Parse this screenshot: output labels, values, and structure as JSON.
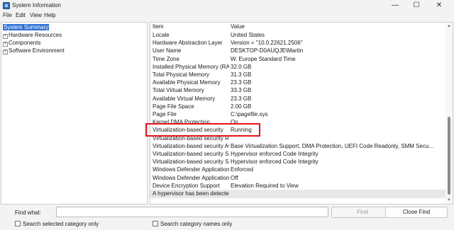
{
  "window": {
    "title": "System Information"
  },
  "menu": [
    "File",
    "Edit",
    "View",
    "Help"
  ],
  "tree": [
    {
      "label": "System Summary",
      "selected": true,
      "expandable": false
    },
    {
      "label": "Hardware Resources",
      "expandable": true
    },
    {
      "label": "Components",
      "expandable": true
    },
    {
      "label": "Software Environment",
      "expandable": true
    }
  ],
  "table": {
    "headers": [
      "Item",
      "Value"
    ],
    "rows": [
      [
        "Locale",
        "United States"
      ],
      [
        "Hardware Abstraction Layer",
        "Version = \"10.0.22621.2506\""
      ],
      [
        "User Name",
        "DESKTOP-D0AUQJE\\Martin"
      ],
      [
        "Time Zone",
        "W. Europe Standard Time"
      ],
      [
        "Installed Physical Memory (RAM)",
        "32.0 GB"
      ],
      [
        "Total Physical Memory",
        "31.3 GB"
      ],
      [
        "Available Physical Memory",
        "23.3 GB"
      ],
      [
        "Total Virtual Memory",
        "33.3 GB"
      ],
      [
        "Available Virtual Memory",
        "23.3 GB"
      ],
      [
        "Page File Space",
        "2.00 GB"
      ],
      [
        "Page File",
        "C:\\pagefile.sys"
      ],
      [
        "Kernel DMA Protection",
        "On"
      ],
      [
        "Virtualization-based security",
        "Running"
      ],
      [
        "Virtualization-based security Re...",
        ""
      ],
      [
        "Virtualization-based security Av...",
        "Base Virtualization Support, DMA Protection, UEFI Code Readonly, SMM Secu..."
      ],
      [
        "Virtualization-based security Se...",
        "Hypervisor enforced Code Integrity"
      ],
      [
        "Virtualization-based security Se...",
        "Hypervisor enforced Code Integrity"
      ],
      [
        "Windows Defender Application...",
        "Enforced"
      ],
      [
        "Windows Defender Application...",
        "Off"
      ],
      [
        "Device Encryption Support",
        "Elevation Required to View"
      ],
      [
        "A hypervisor has been detected...",
        ""
      ]
    ]
  },
  "find": {
    "label": "Find what:",
    "value": "",
    "find_button": "Find",
    "close_button": "Close Find",
    "search_selected": "Search selected category only",
    "search_names": "Search category names only"
  },
  "colors": {
    "highlight": "#e3151a",
    "selection": "#2e6fd3"
  }
}
